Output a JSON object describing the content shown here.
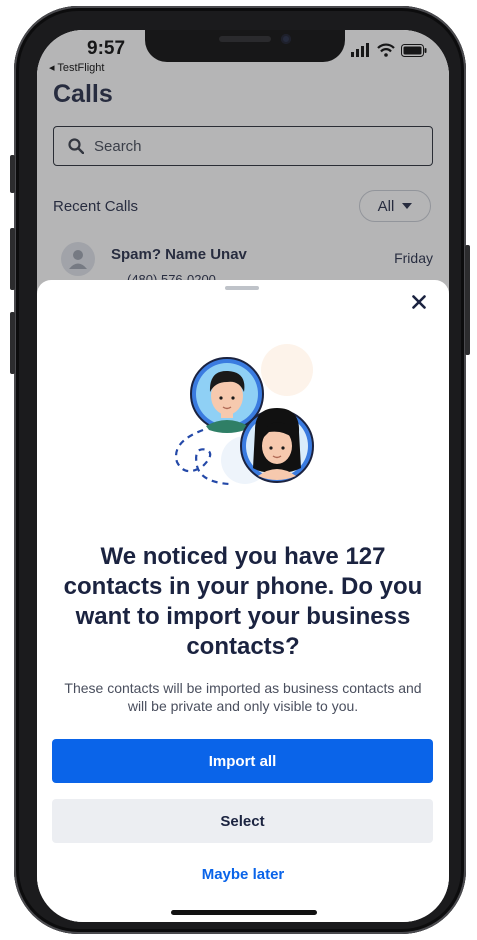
{
  "status_bar": {
    "time": "9:57",
    "back_app": "◂ TestFlight"
  },
  "background": {
    "title": "Calls",
    "search_placeholder": "Search",
    "recent_label": "Recent Calls",
    "filter_value": "All",
    "call": {
      "name": "Spam? Name Unav",
      "day": "Friday",
      "number": "(480) 576-0200"
    }
  },
  "sheet": {
    "headline": "We noticed you have 127 contacts in your phone. Do you want to import your business contacts?",
    "subtext": "These contacts will be imported as business contacts and will be private and only visible to you.",
    "import_all": "Import all",
    "select": "Select",
    "maybe_later": "Maybe later"
  },
  "colors": {
    "primary": "#0a64e9",
    "navy_text": "#1b2340",
    "secondary_button": "#eceef2"
  },
  "icons": [
    "search-icon",
    "chevron-down-icon",
    "close-icon",
    "signal-icon",
    "wifi-icon",
    "battery-icon",
    "person-icon"
  ]
}
